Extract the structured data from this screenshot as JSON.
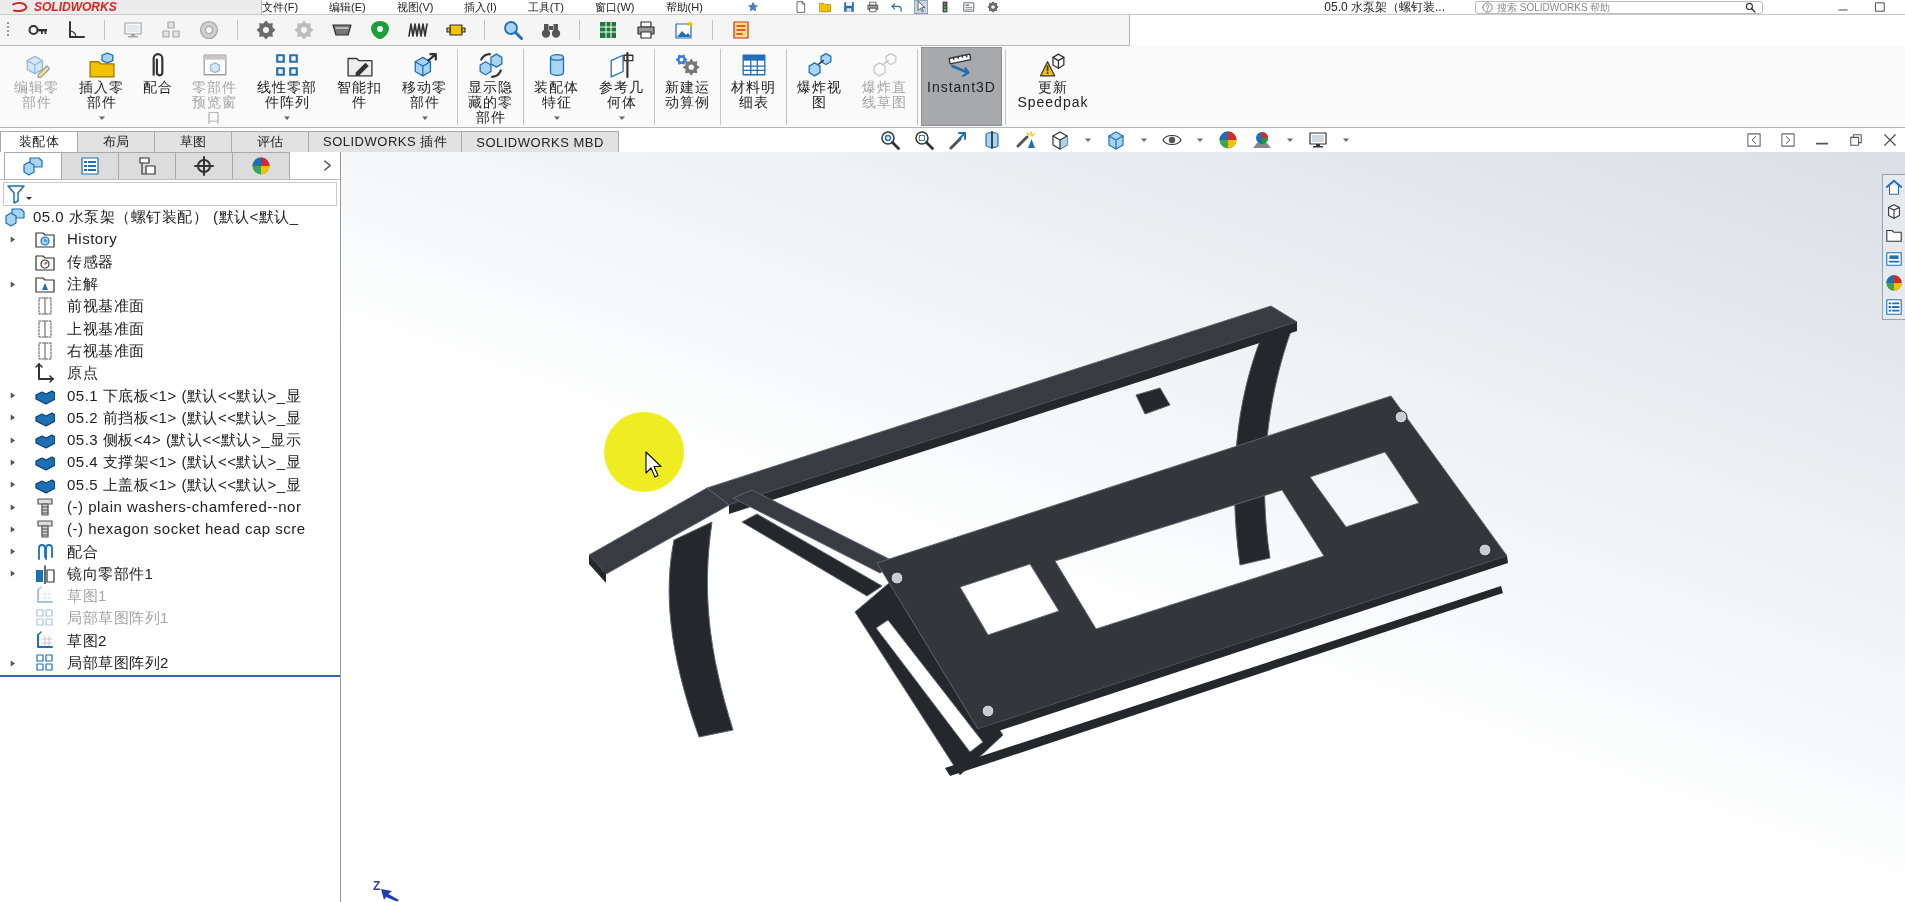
{
  "title_bar": {
    "logo": "SOLIDWORKS",
    "menu": [
      "文件(F)",
      "编辑(E)",
      "视图(V)",
      "插入(I)",
      "工具(T)",
      "窗口(W)",
      "帮助(H)"
    ],
    "quick_access": [
      {
        "selected": false
      },
      {
        "selected": false
      },
      {
        "selected": false
      },
      {
        "selected": false
      },
      {
        "selected": false
      },
      {
        "selected": true
      },
      {
        "selected": false
      },
      {
        "selected": false
      },
      {
        "selected": false
      }
    ],
    "document_title": "05.0 水泵架（螺钉装...",
    "search": {
      "placeholder": "搜索 SOLIDWORKS 帮助"
    }
  },
  "toolbar": [
    {
      "disabled": false
    },
    {
      "disabled": false
    },
    {
      "disabled": true
    },
    {
      "disabled": true
    },
    {
      "disabled": true
    },
    {
      "disabled": false
    },
    {
      "disabled": true
    },
    {
      "disabled": false
    },
    {
      "disabled": false
    },
    {
      "disabled": false
    },
    {
      "disabled": false
    },
    {
      "disabled": false
    },
    {
      "disabled": false
    },
    {
      "disabled": false
    },
    {
      "disabled": false
    },
    {
      "disabled": false
    },
    {
      "disabled": false
    }
  ],
  "command_manager": {
    "buttons": [
      {
        "label": "编辑零部件",
        "disabled": true,
        "dropdown": false,
        "selected": false
      },
      {
        "label": "插入零部件",
        "disabled": false,
        "dropdown": true,
        "selected": false
      },
      {
        "label": "配合",
        "disabled": false,
        "dropdown": false,
        "selected": false
      },
      {
        "label": "零部件预览窗口",
        "disabled": true,
        "dropdown": false,
        "selected": false
      },
      {
        "label": "线性零部件阵列",
        "disabled": false,
        "dropdown": true,
        "selected": false
      },
      {
        "label": "智能扣件",
        "disabled": false,
        "dropdown": false,
        "selected": false
      },
      {
        "label": "移动零部件",
        "disabled": false,
        "dropdown": true,
        "selected": false
      },
      {
        "label": "显示隐藏的零部件",
        "disabled": false,
        "dropdown": false,
        "selected": false
      },
      {
        "label": "装配体特征",
        "disabled": false,
        "dropdown": true,
        "selected": false
      },
      {
        "label": "参考几何体",
        "disabled": false,
        "dropdown": true,
        "selected": false
      },
      {
        "label": "新建运动算例",
        "disabled": false,
        "dropdown": false,
        "selected": false
      },
      {
        "label": "材料明细表",
        "disabled": false,
        "dropdown": false,
        "selected": false
      },
      {
        "label": "爆炸视图",
        "disabled": false,
        "dropdown": false,
        "selected": false
      },
      {
        "label": "爆炸直线草图",
        "disabled": true,
        "dropdown": false,
        "selected": false
      },
      {
        "label": "Instant3D",
        "disabled": false,
        "dropdown": false,
        "selected": true
      },
      {
        "label": "更新 Speedpak",
        "disabled": false,
        "dropdown": false,
        "selected": false
      }
    ]
  },
  "tabs": [
    {
      "label": "装配体",
      "selected": true
    },
    {
      "label": "布局",
      "selected": false
    },
    {
      "label": "草图",
      "selected": false
    },
    {
      "label": "评估",
      "selected": false
    },
    {
      "label": "SOLIDWORKS 插件",
      "selected": false
    },
    {
      "label": "SOLIDWORKS MBD",
      "selected": false
    }
  ],
  "feature_manager": {
    "panel_tabs": [
      {
        "selected": true
      },
      {
        "selected": false
      },
      {
        "selected": false
      },
      {
        "selected": false
      },
      {
        "selected": false
      }
    ],
    "tree": {
      "label": "05.0 水泵架（螺钉装配） (默认<默认_",
      "kind": "assembly",
      "expandable": false,
      "suppressed": false,
      "children": [
        {
          "label": "History",
          "kind": "history-folder",
          "expandable": true,
          "suppressed": false
        },
        {
          "label": "传感器",
          "kind": "sensor-folder",
          "expandable": false,
          "suppressed": false
        },
        {
          "label": "注解",
          "kind": "annotation-folder",
          "expandable": true,
          "suppressed": false
        },
        {
          "label": "前视基准面",
          "kind": "plane",
          "expandable": false,
          "suppressed": false
        },
        {
          "label": "上视基准面",
          "kind": "plane",
          "expandable": false,
          "suppressed": false
        },
        {
          "label": "右视基准面",
          "kind": "plane",
          "expandable": false,
          "suppressed": false
        },
        {
          "label": "原点",
          "kind": "origin",
          "expandable": false,
          "suppressed": false
        },
        {
          "label": "05.1 下底板<1> (默认<<默认>_显",
          "kind": "part",
          "expandable": true,
          "suppressed": false
        },
        {
          "label": "05.2 前挡板<1> (默认<<默认>_显",
          "kind": "part",
          "expandable": true,
          "suppressed": false
        },
        {
          "label": "05.3 侧板<4> (默认<<默认>_显示",
          "kind": "part",
          "expandable": true,
          "suppressed": false
        },
        {
          "label": "05.4 支撑架<1> (默认<<默认>_显",
          "kind": "part",
          "expandable": true,
          "suppressed": false
        },
        {
          "label": "05.5 上盖板<1> (默认<<默认>_显",
          "kind": "part",
          "expandable": true,
          "suppressed": false
        },
        {
          "label": "(-) plain washers-chamfered--nor",
          "kind": "fastener",
          "expandable": true,
          "suppressed": false
        },
        {
          "label": "(-) hexagon socket head cap scre",
          "kind": "fastener",
          "expandable": true,
          "suppressed": false
        },
        {
          "label": "配合",
          "kind": "mates",
          "expandable": true,
          "suppressed": false
        },
        {
          "label": "镜向零部件1",
          "kind": "mirror",
          "expandable": true,
          "suppressed": false
        },
        {
          "label": "草图1",
          "kind": "sketch",
          "expandable": false,
          "suppressed": true
        },
        {
          "label": "局部草图阵列1",
          "kind": "sketch-pattern",
          "expandable": false,
          "suppressed": true
        },
        {
          "label": "草图2",
          "kind": "sketch",
          "expandable": false,
          "suppressed": false
        },
        {
          "label": "局部草图阵列2",
          "kind": "sketch-pattern",
          "expandable": true,
          "suppressed": false
        }
      ]
    }
  },
  "viewport": {
    "triad": {
      "z_label": "Z"
    }
  }
}
